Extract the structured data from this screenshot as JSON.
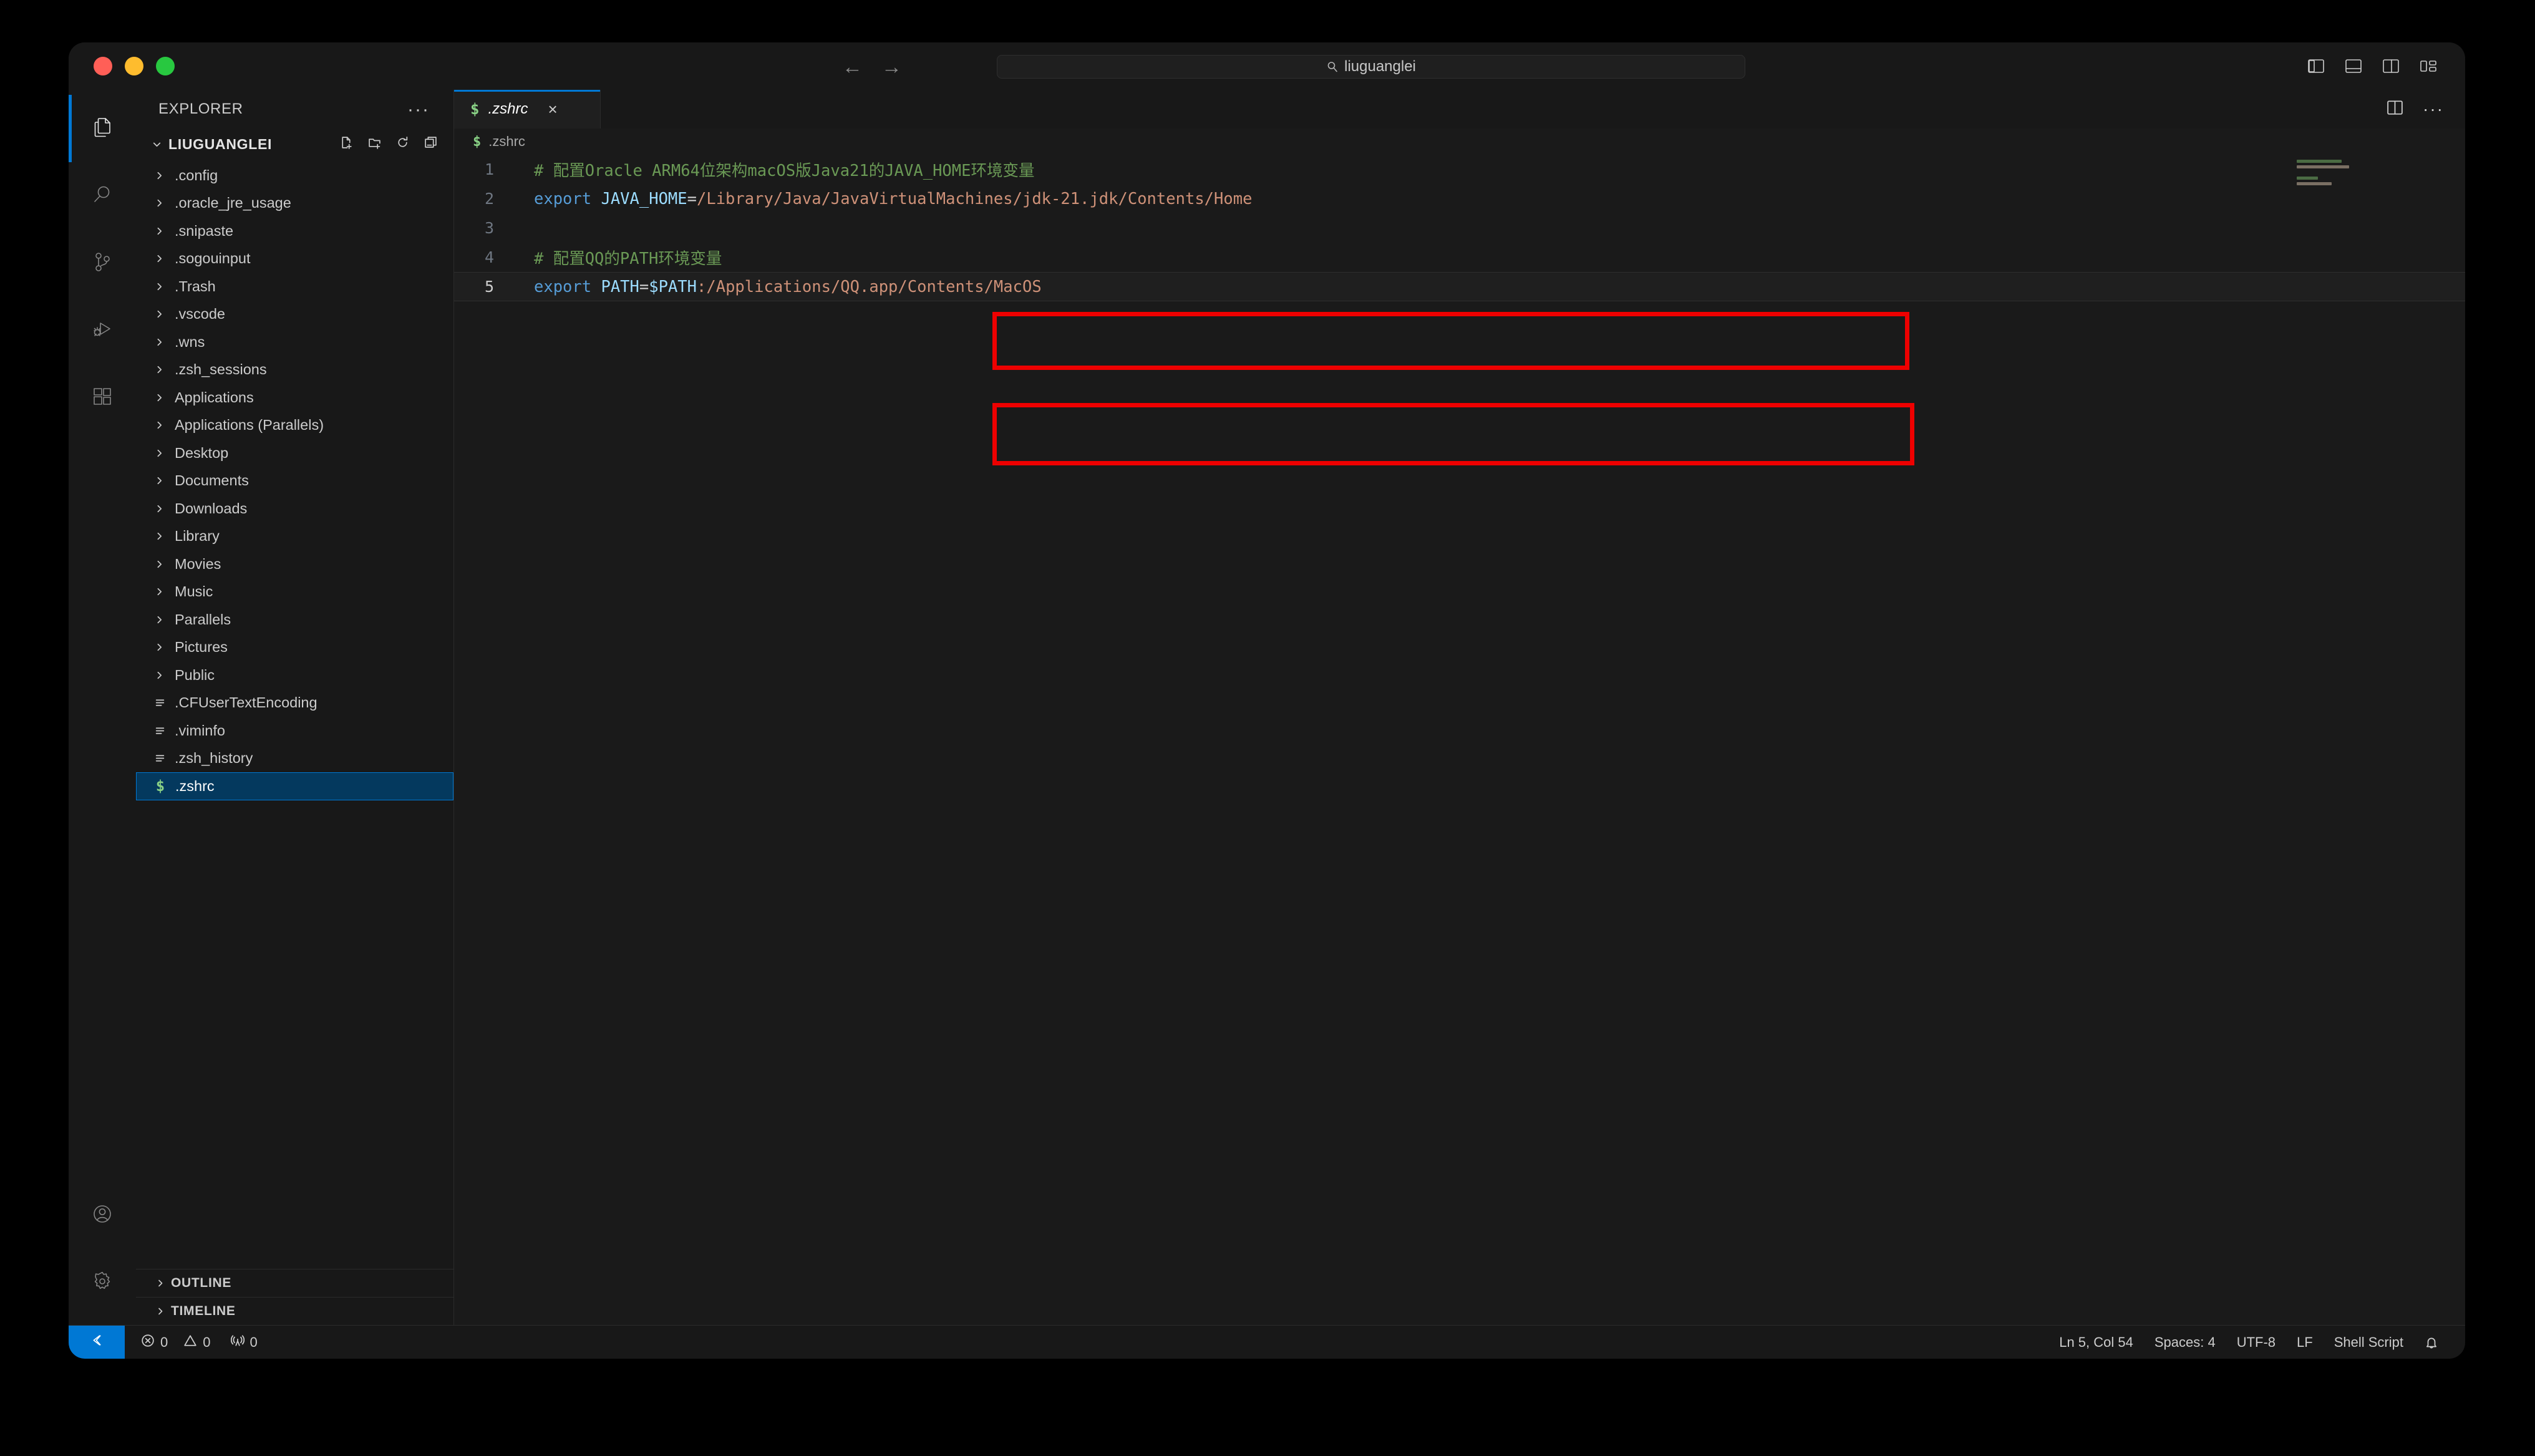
{
  "window": {
    "traffic_lights": [
      "close",
      "minimize",
      "zoom"
    ],
    "command_center": {
      "text": "liuguanglei",
      "icon": "search-icon"
    },
    "nav_back": "←",
    "nav_forward": "→",
    "layout_buttons": [
      "toggle-primary-sidebar",
      "toggle-panel",
      "toggle-secondary-sidebar",
      "customize-layout"
    ]
  },
  "activitybar": {
    "items": [
      {
        "name": "explorer",
        "icon": "files-icon",
        "active": true
      },
      {
        "name": "search",
        "icon": "search-icon",
        "active": false
      },
      {
        "name": "source-control",
        "icon": "source-control-icon",
        "active": false
      },
      {
        "name": "run-and-debug",
        "icon": "debug-icon",
        "active": false
      },
      {
        "name": "extensions",
        "icon": "extensions-icon",
        "active": false
      }
    ],
    "bottom": [
      {
        "name": "accounts",
        "icon": "account-icon"
      },
      {
        "name": "manage",
        "icon": "gear-icon"
      }
    ]
  },
  "sidebar": {
    "header_title": "EXPLORER",
    "header_more": "···",
    "folder": {
      "name": "LIUGUANGLEI",
      "expanded": true,
      "actions": [
        "new-file",
        "new-folder",
        "refresh-explorer",
        "collapse-folders"
      ]
    },
    "tree": [
      {
        "label": ".config",
        "type": "folder",
        "expanded": false,
        "selected": false
      },
      {
        "label": ".oracle_jre_usage",
        "type": "folder",
        "expanded": false,
        "selected": false
      },
      {
        "label": ".snipaste",
        "type": "folder",
        "expanded": false,
        "selected": false
      },
      {
        "label": ".sogouinput",
        "type": "folder",
        "expanded": false,
        "selected": false
      },
      {
        "label": ".Trash",
        "type": "folder",
        "expanded": false,
        "selected": false
      },
      {
        "label": ".vscode",
        "type": "folder",
        "expanded": false,
        "selected": false
      },
      {
        "label": ".wns",
        "type": "folder",
        "expanded": false,
        "selected": false
      },
      {
        "label": ".zsh_sessions",
        "type": "folder",
        "expanded": false,
        "selected": false
      },
      {
        "label": "Applications",
        "type": "folder",
        "expanded": false,
        "selected": false
      },
      {
        "label": "Applications (Parallels)",
        "type": "folder",
        "expanded": false,
        "selected": false
      },
      {
        "label": "Desktop",
        "type": "folder",
        "expanded": false,
        "selected": false
      },
      {
        "label": "Documents",
        "type": "folder",
        "expanded": false,
        "selected": false
      },
      {
        "label": "Downloads",
        "type": "folder",
        "expanded": false,
        "selected": false
      },
      {
        "label": "Library",
        "type": "folder",
        "expanded": false,
        "selected": false
      },
      {
        "label": "Movies",
        "type": "folder",
        "expanded": false,
        "selected": false
      },
      {
        "label": "Music",
        "type": "folder",
        "expanded": false,
        "selected": false
      },
      {
        "label": "Parallels",
        "type": "folder",
        "expanded": false,
        "selected": false
      },
      {
        "label": "Pictures",
        "type": "folder",
        "expanded": false,
        "selected": false
      },
      {
        "label": "Public",
        "type": "folder",
        "expanded": false,
        "selected": false
      },
      {
        "label": ".CFUserTextEncoding",
        "type": "file",
        "expanded": false,
        "selected": false
      },
      {
        "label": ".viminfo",
        "type": "file",
        "expanded": false,
        "selected": false
      },
      {
        "label": ".zsh_history",
        "type": "file",
        "expanded": false,
        "selected": false
      },
      {
        "label": ".zshrc",
        "type": "shell",
        "expanded": false,
        "selected": true
      }
    ],
    "sections": [
      {
        "label": "OUTLINE",
        "expanded": false
      },
      {
        "label": "TIMELINE",
        "expanded": false
      }
    ]
  },
  "editor": {
    "tab": {
      "label": ".zshrc",
      "icon": "shell-script-icon",
      "dirty": false,
      "close": "×",
      "active": true
    },
    "tab_actions": [
      "split-editor-right",
      "more-editor-actions"
    ],
    "tab_more": "···",
    "breadcrumb": {
      "icon": "shell-script-icon",
      "label": ".zshrc"
    },
    "lines": [
      {
        "number": "1",
        "active": false,
        "tokens": [
          {
            "text": "# 配置Oracle ARM64位架构macOS版Java21的JAVA_HOME环境变量",
            "kind": "comment"
          }
        ]
      },
      {
        "number": "2",
        "active": false,
        "tokens": [
          {
            "text": "export ",
            "kind": "kw"
          },
          {
            "text": "JAVA_HOME",
            "kind": "var"
          },
          {
            "text": "=",
            "kind": "op"
          },
          {
            "text": "/Library/Java/JavaVirtualMachines/jdk-21.jdk/Contents/Home",
            "kind": "str"
          }
        ]
      },
      {
        "number": "3",
        "active": false,
        "tokens": [
          {
            "text": "",
            "kind": "op"
          }
        ]
      },
      {
        "number": "4",
        "active": false,
        "tokens": [
          {
            "text": "# 配置QQ的PATH环境变量",
            "kind": "comment"
          }
        ]
      },
      {
        "number": "5",
        "active": true,
        "tokens": [
          {
            "text": "export ",
            "kind": "kw"
          },
          {
            "text": "PATH",
            "kind": "var"
          },
          {
            "text": "=",
            "kind": "op"
          },
          {
            "text": "$PATH",
            "kind": "var"
          },
          {
            "text": ":/Applications/QQ.app/Contents/MacOS",
            "kind": "str"
          }
        ]
      }
    ],
    "annotations": [
      {
        "name": "highlight-box-java-home",
        "color": "#ee0000"
      },
      {
        "name": "highlight-box-qq-path",
        "color": "#ee0000"
      }
    ],
    "minimap_lines": [
      {
        "color": "#4b6b43",
        "width": 72
      },
      {
        "color": "#7a6f63",
        "width": 84
      },
      {
        "color": "#000000",
        "width": 0
      },
      {
        "color": "#4b6b43",
        "width": 34
      },
      {
        "color": "#7a6f63",
        "width": 56
      }
    ]
  },
  "statusbar": {
    "remote": {
      "icon": "remote-icon",
      "label": ""
    },
    "left": [
      {
        "name": "problems-errors",
        "icon": "error-icon",
        "value": "0"
      },
      {
        "name": "problems-warnings",
        "icon": "warning-icon",
        "value": "0"
      },
      {
        "name": "ports",
        "icon": "radio-tower-icon",
        "value": "0"
      }
    ],
    "right": [
      {
        "name": "editor-position",
        "label": "Ln 5, Col 54"
      },
      {
        "name": "editor-indentation",
        "label": "Spaces: 4"
      },
      {
        "name": "editor-encoding",
        "label": "UTF-8"
      },
      {
        "name": "editor-eol",
        "label": "LF"
      },
      {
        "name": "editor-language",
        "label": "Shell Script"
      }
    ],
    "bell": {
      "name": "notifications-bell",
      "icon": "bell-icon"
    }
  },
  "colors": {
    "accent": "#0078d4",
    "selection_bg": "#04395e",
    "annotation_red": "#ee0000",
    "comment_green": "#6a9955",
    "keyword_blue": "#569cd6",
    "variable_blue": "#9cdcfe",
    "string_orange": "#ce9178",
    "shell_icon_green": "#89d185"
  }
}
